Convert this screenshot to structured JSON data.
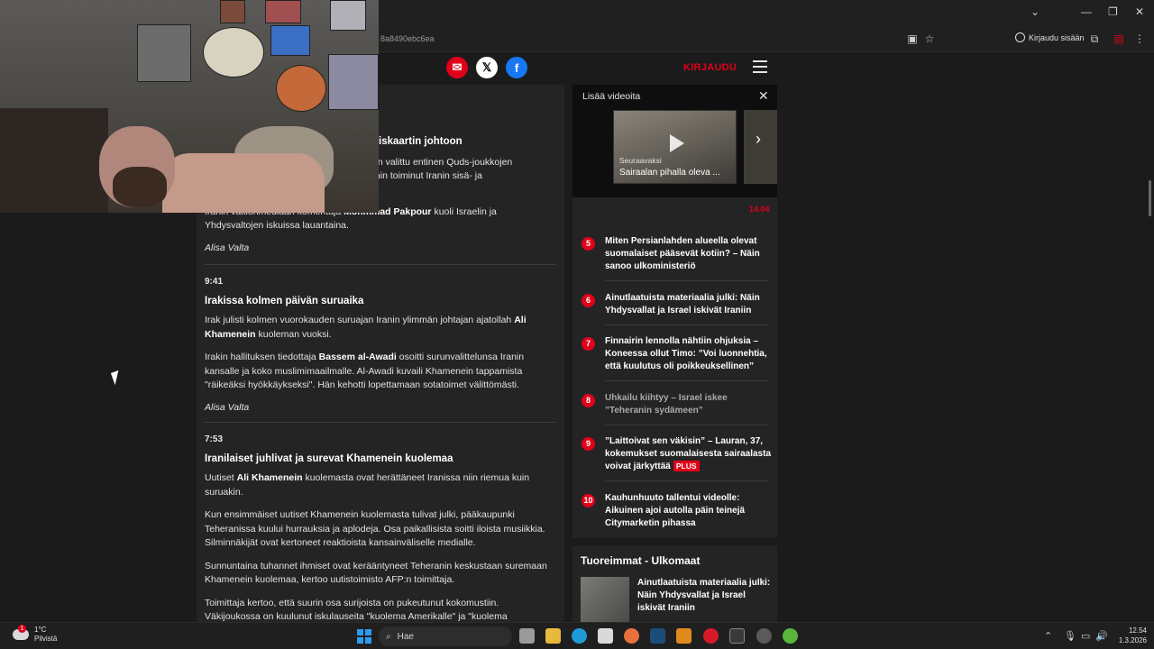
{
  "browser": {
    "url": "8a8490ebc6ea",
    "login_label": "Kirjaudu sisään"
  },
  "site": {
    "login_label": "KIRJAUDU"
  },
  "article": {
    "top_headline_fragment": "iskaartin johtoon",
    "top_text_1": "on valittu entinen Quds-joukkojen",
    "top_text_2": "min toiminut Iranin sisä- ja",
    "top_p2_pre": "Iranin valtionmediaan komentaja ",
    "top_p2_bold": "Mohmmad Pakpour",
    "top_p2_post": " kuoli Israelin ja Yhdysvaltojen iskuissa lauantaina.",
    "author": "Alisa Valta",
    "entries": [
      {
        "time": "9:41",
        "headline": "Irakissa kolmen päivän suruaika",
        "p1_pre": "Irak julisti kolmen vuorokauden suruajan Iranin ylimmän johtajan ajatollah ",
        "p1_bold": "Ali Khamenein",
        "p1_post": " kuoleman vuoksi.",
        "p2_pre": "Irakin hallituksen tiedottaja ",
        "p2_bold": "Bassem al-Awadi",
        "p2_post": " osoitti surunvalittelunsa Iranin kansalle ja koko muslimimaailmalle. Al-Awadi kuvaili Khamenein tappamista \"räikeäksi hyökkäykseksi\". Hän kehotti lopettamaan sotatoimet välittömästi.",
        "author": "Alisa Valta"
      },
      {
        "time": "7:53",
        "headline": "Iranilaiset juhlivat ja surevat Khamenein kuolemaa",
        "p1_pre": "Uutiset ",
        "p1_bold": "Ali Khamenein",
        "p1_post": " kuolemasta ovat herättäneet Iranissa niin riemua kuin suruakin.",
        "p2": "Kun ensimmäiset uutiset Khamenein kuolemasta tulivat julki, pääkaupunki Teheranissa kuului hurrauksia ja aplodeja. Osa paikallisista soitti iloista musiikkia. Silminnäkijät ovat kertoneet reaktioista kansainväliselle medialle.",
        "p3": "Sunnuntaina tuhannet ihmiset ovat kerääntyneet Teheranin keskustaan suremaan Khamenein kuolemaa, kertoo uutistoimisto AFP:n toimittaja.",
        "p4": "Toimittaja kertoo, että suurin osa surijoista on pukeutunut kokomustiin. Väkijoukossa on kuulunut iskulauseita \"kuolema Amerikalle\" ja \"kuolema"
      }
    ]
  },
  "video": {
    "title": "Lisää videoita",
    "next_label": "Seuraavaksi",
    "caption": "Sairaalan pihalla oleva ..."
  },
  "most_read": {
    "top_label": "14.04",
    "items": [
      {
        "num": "5",
        "text": "Miten Persianlahden alueella olevat suomalaiset pääsevät kotiin? – Näin sanoo ulkoministeriö",
        "dim": false
      },
      {
        "num": "6",
        "text": "Ainutlaatuista materiaalia julki: Näin Yhdysvallat ja Israel iskivät Iraniin",
        "dim": false
      },
      {
        "num": "7",
        "text": "Finnairin lennolla nähtiin ohjuksia – Koneessa ollut Timo: ”Voi luonnehtia, että kuulutus oli poikkeuksellinen”",
        "dim": false
      },
      {
        "num": "8",
        "text": "Uhkailu kiihtyy – Israel iskee ”Teheranin sydämeen”",
        "dim": true
      },
      {
        "num": "9",
        "text": "”Laittoivat sen väkisin” – Lauran, 37, kokemukset suomalaisesta sairaalasta voivat järkyttää",
        "dim": false,
        "badge": "PLUS"
      },
      {
        "num": "10",
        "text": "Kauhunhuuto tallentui videolle: Aikuinen ajoi autolla päin teinejä Citymarketin pihassa",
        "dim": false
      }
    ]
  },
  "latest": {
    "title": "Tuoreimmat - Ulkomaat",
    "item": "Ainutlaatuista materiaalia julki: Näin Yhdysvallat ja Israel iskivät Iraniin"
  },
  "taskbar": {
    "temp": "1°C",
    "weather": "Pilvistä",
    "weather_badge": "1",
    "search": "Hae",
    "time": "12.54",
    "date": "1.3.2026"
  },
  "colors": {
    "accent": "#e1001a",
    "bg": "#1b1b1b",
    "panel": "#242424"
  }
}
